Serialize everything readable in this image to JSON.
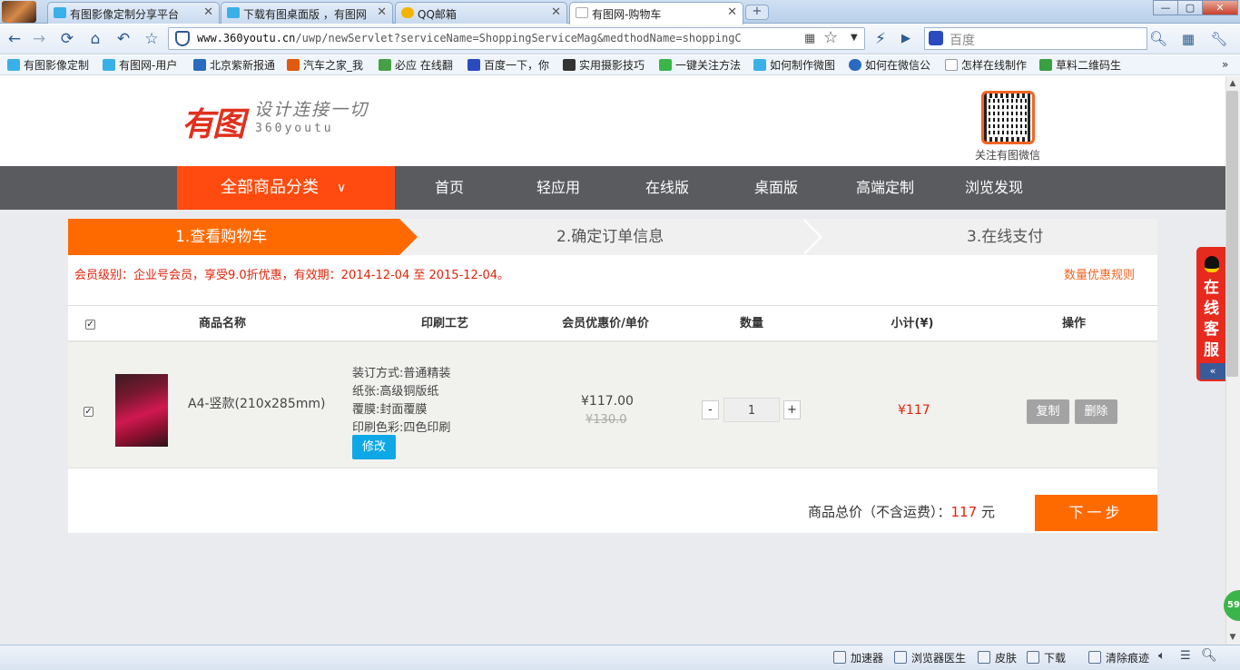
{
  "browser": {
    "tabs": [
      {
        "title": "有图影像定制分享平台",
        "fav": "#3ab0e8"
      },
      {
        "title": "下载有图桌面版 ，有图网",
        "fav": "#3ab0e8"
      },
      {
        "title": "QQ邮箱",
        "fav": "#f4b400"
      },
      {
        "title": "有图网-购物车",
        "fav": "#cccccc"
      }
    ],
    "new_tab_label": "+",
    "window_controls": {
      "minimize": "—",
      "maximize": "▢",
      "close": "✕"
    },
    "url_host": "www.360youtu.cn",
    "url_path": "/uwp/newServlet?serviceName=ShoppingServiceMag&medthodName=shoppingC",
    "search_placeholder": "百度",
    "bookmarks": [
      {
        "label": "有图影像定制",
        "color": "#3ab0e8"
      },
      {
        "label": "有图网-用户",
        "color": "#3ab0e8"
      },
      {
        "label": "北京紫新报通",
        "color": "#2a6ac0"
      },
      {
        "label": "汽车之家_我",
        "color": "#e05a10"
      },
      {
        "label": "必应 在线翻",
        "color": "#46a046"
      },
      {
        "label": "百度一下，你",
        "color": "#2a4ac0"
      },
      {
        "label": "实用摄影技巧",
        "color": "#333333"
      },
      {
        "label": "一键关注方法",
        "color": "#3ab54a"
      },
      {
        "label": "如何制作微图",
        "color": "#3ab0e8"
      },
      {
        "label": "如何在微信公",
        "color": "#2a6ac0"
      },
      {
        "label": "怎样在线制作",
        "color": "#dddddd"
      },
      {
        "label": "草料二维码生",
        "color": "#3aa040"
      }
    ],
    "status_items": [
      "加速器",
      "浏览器医生",
      "皮肤",
      "下载",
      "清除痕迹"
    ]
  },
  "site": {
    "logo_text": "有图",
    "slogan": "设计连接一切",
    "logo_sub": "360youtu",
    "qr_label": "关注有图微信",
    "all_categories": "全部商品分类",
    "nav": [
      "首页",
      "轻应用",
      "在线版",
      "桌面版",
      "高端定制",
      "浏览发现"
    ],
    "online_service": "在线客服",
    "collapse": "«",
    "badge": "59"
  },
  "cart": {
    "steps": [
      "1.查看购物车",
      "2.确定订单信息",
      "3.在线支付"
    ],
    "member_notice": "会员级别：企业号会员，享受9.0折优惠，有效期：2014-12-04 至 2015-12-04。",
    "qty_rule_link": "数量优惠规则",
    "columns": [
      "商品名称",
      "印刷工艺",
      "会员优惠价/单价",
      "数量",
      "小计(¥)",
      "操作"
    ],
    "items": [
      {
        "name": "A4-竖款(210x285mm)",
        "craft": [
          "装订方式:普通精装",
          "纸张:高级铜版纸",
          "覆膜:封面覆膜",
          "印刷色彩:四色印刷"
        ],
        "edit_label": "修改",
        "price": "¥117.00",
        "old_price": "¥130.0",
        "qty": "1",
        "subtotal": "¥117",
        "copy_label": "复制",
        "delete_label": "删除"
      }
    ],
    "minus": "-",
    "plus": "+",
    "total_label": "商品总价（不含运费）：",
    "total_value": "117",
    "total_unit": "元",
    "next_label": "下一步"
  }
}
